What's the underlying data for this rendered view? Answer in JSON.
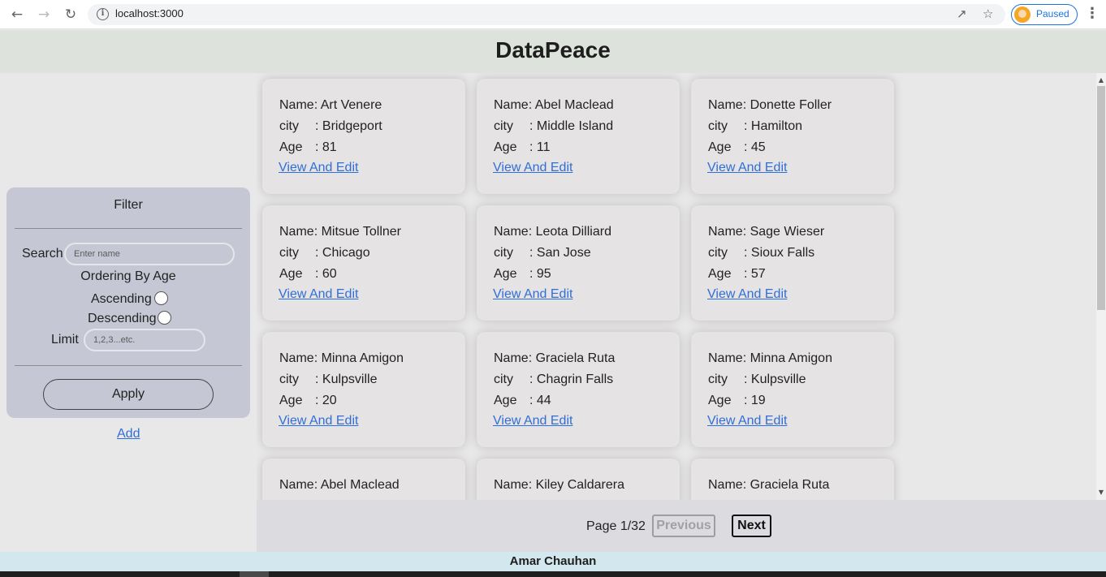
{
  "browser": {
    "url": "localhost:3000",
    "profile_status": "Paused"
  },
  "header": {
    "title": "DataPeace"
  },
  "filter": {
    "title": "Filter",
    "search_label": "Search",
    "search_placeholder": "Enter name",
    "ordering_label": "Ordering By Age",
    "ascending_label": "Ascending",
    "descending_label": "Descending",
    "limit_label": "Limit",
    "limit_placeholder": "1,2,3...etc.",
    "apply_label": "Apply",
    "add_label": "Add"
  },
  "labels": {
    "name": "Name",
    "city": "city",
    "age": "Age",
    "view_edit": "View And Edit"
  },
  "cards": [
    {
      "name": "Art Venere",
      "city": "Bridgeport",
      "age": "81"
    },
    {
      "name": "Abel Maclead",
      "city": "Middle Island",
      "age": "11"
    },
    {
      "name": "Donette Foller",
      "city": "Hamilton",
      "age": "45"
    },
    {
      "name": "Mitsue Tollner",
      "city": "Chicago",
      "age": "60"
    },
    {
      "name": "Leota Dilliard",
      "city": "San Jose",
      "age": "95"
    },
    {
      "name": "Sage Wieser",
      "city": "Sioux Falls",
      "age": "57"
    },
    {
      "name": "Minna Amigon",
      "city": "Kulpsville",
      "age": "20"
    },
    {
      "name": "Graciela Ruta",
      "city": "Chagrin Falls",
      "age": "44"
    },
    {
      "name": "Minna Amigon",
      "city": "Kulpsville",
      "age": "19"
    },
    {
      "name": "Abel Maclead",
      "city": "",
      "age": ""
    },
    {
      "name": "Kiley Caldarera",
      "city": "",
      "age": ""
    },
    {
      "name": "Graciela Ruta",
      "city": "",
      "age": ""
    }
  ],
  "pagination": {
    "page_text": "Page 1/32",
    "previous_label": "Previous",
    "next_label": "Next"
  },
  "footer": {
    "text": "Amar Chauhan"
  }
}
